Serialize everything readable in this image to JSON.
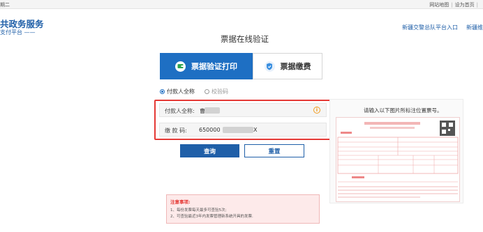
{
  "topbar": {
    "left_text": "期二",
    "links": [
      "网站地图",
      "设为首页"
    ]
  },
  "brand": {
    "title": "共政务服务",
    "subtitle": "支付平台 ——"
  },
  "nav": {
    "link1": "新疆交警总队平台入口",
    "link2": "新疆维"
  },
  "page_title": "票据在线验证",
  "tabs": [
    {
      "label": "票据验证打印",
      "icon": "wallet-icon",
      "active": true
    },
    {
      "label": "票据缴费",
      "icon": "shield-icon",
      "active": false
    }
  ],
  "radios": [
    {
      "label": "付款人全称",
      "checked": true
    },
    {
      "label": "校验码",
      "checked": false
    }
  ],
  "form": {
    "payer": {
      "label": "付款人全称:",
      "value_visible": "曹"
    },
    "code": {
      "label": "缴 款 码:",
      "value_start": "650000",
      "value_end": "X"
    }
  },
  "buttons": {
    "query": "查询",
    "reset": "重置"
  },
  "notice": {
    "title": "注意事项:",
    "lines": [
      "1、每份发票每天最多可查验5次;",
      "2、可查验最近3年内发票管理新系统开具的发票."
    ]
  },
  "sample": {
    "hint": "请输入以下图片所标注位置票号。"
  },
  "colors": {
    "primary": "#1e6fc3",
    "alert": "#e53935",
    "warning": "#f29c1f"
  }
}
